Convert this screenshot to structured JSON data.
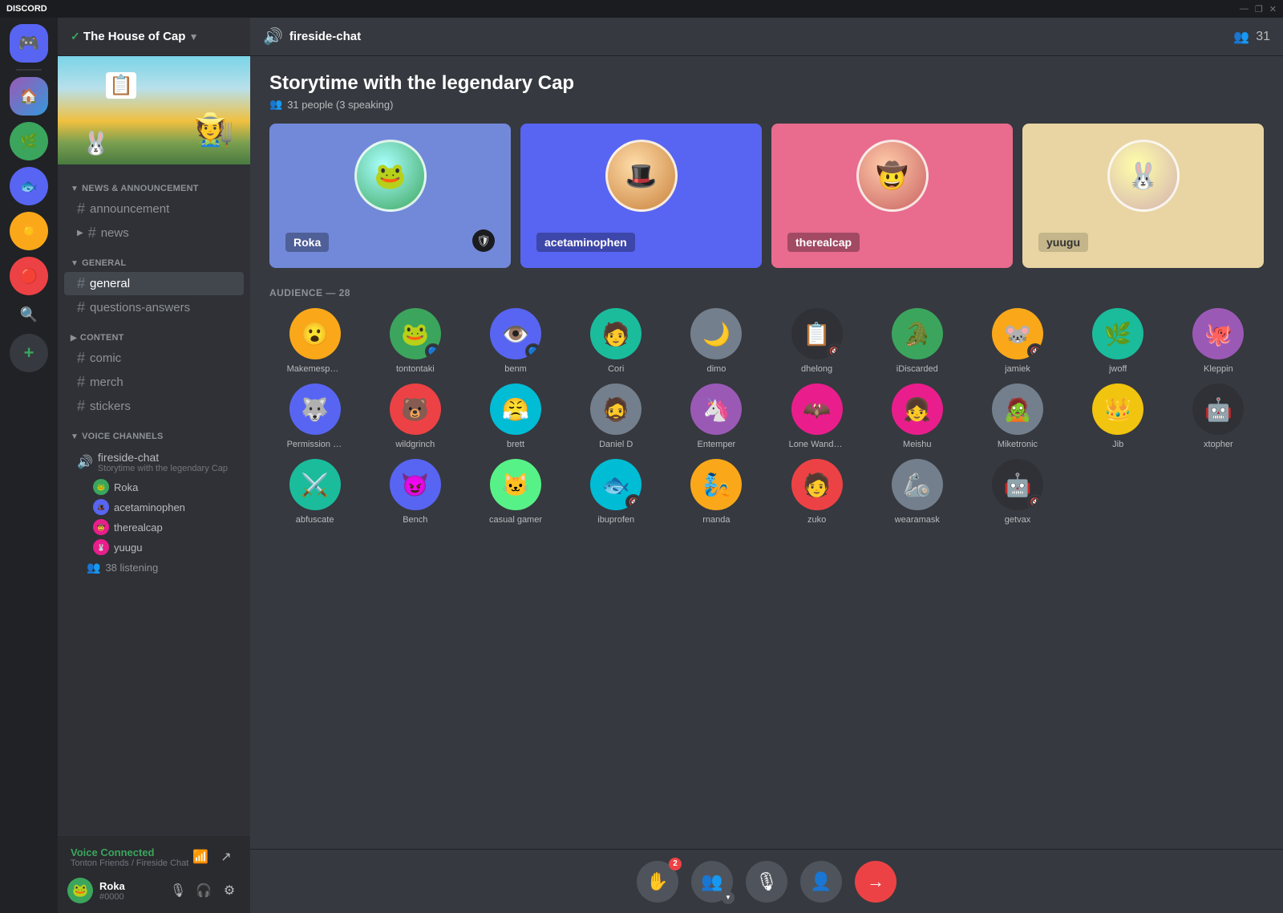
{
  "titlebar": {
    "app_name": "DISCORD",
    "controls": [
      "—",
      "❐",
      "✕"
    ]
  },
  "server": {
    "name": "The House of Cap",
    "banner_emoji": "🏠"
  },
  "channel_header": {
    "icon": "🔊",
    "name": "fireside-chat",
    "listener_count": "31"
  },
  "stage": {
    "title": "Storytime with the legendary Cap",
    "people_count": "31",
    "speaking_count": "3",
    "meta": "31 people (3 speaking)"
  },
  "speakers": [
    {
      "id": "roka",
      "name": "Roka",
      "card_class": "speaker-card-blue",
      "avatar_emoji": "🐸",
      "has_shield": true
    },
    {
      "id": "acetaminophen",
      "name": "acetaminophen",
      "card_class": "speaker-card-darkblue",
      "avatar_emoji": "🎩",
      "has_shield": false
    },
    {
      "id": "therealcap",
      "name": "therealcap",
      "card_class": "speaker-card-pink",
      "avatar_emoji": "🤠",
      "has_shield": false
    },
    {
      "id": "yuugu",
      "name": "yuugu",
      "card_class": "speaker-card-cream",
      "avatar_emoji": "🐰",
      "has_shield": false
    }
  ],
  "audience": {
    "label": "AUDIENCE — 28",
    "members": [
      {
        "name": "Makemespeakrr",
        "emoji": "😮",
        "color": "av-orange"
      },
      {
        "name": "tontontaki",
        "emoji": "🐸",
        "color": "av-green",
        "badge": "🔵"
      },
      {
        "name": "benm",
        "emoji": "👁️",
        "color": "av-blue",
        "badge": "🔵"
      },
      {
        "name": "Cori",
        "emoji": "🧑",
        "color": "av-teal"
      },
      {
        "name": "dimo",
        "emoji": "🌙",
        "color": "av-grey"
      },
      {
        "name": "dhelong",
        "emoji": "📋",
        "color": "av-dark",
        "badge": "🔇"
      },
      {
        "name": "iDiscarded",
        "emoji": "🐊",
        "color": "av-green"
      },
      {
        "name": "jamiek",
        "emoji": "🐭",
        "color": "av-orange",
        "badge": "🔇"
      },
      {
        "name": "jwoff",
        "emoji": "🌿",
        "color": "av-teal"
      },
      {
        "name": "Kleppin",
        "emoji": "🐙",
        "color": "av-purple"
      },
      {
        "name": "Permission Man",
        "emoji": "🐺",
        "color": "av-blue"
      },
      {
        "name": "wildgrinch",
        "emoji": "🐻",
        "color": "av-red"
      },
      {
        "name": "brett",
        "emoji": "😤",
        "color": "av-cyan"
      },
      {
        "name": "Daniel D",
        "emoji": "🧔",
        "color": "av-grey"
      },
      {
        "name": "Entemper",
        "emoji": "🦄",
        "color": "av-purple"
      },
      {
        "name": "Lone Wanderer",
        "emoji": "🦇",
        "color": "av-pink"
      },
      {
        "name": "Meishu",
        "emoji": "👧",
        "color": "av-pink"
      },
      {
        "name": "Miketronic",
        "emoji": "🧟",
        "color": "av-grey"
      },
      {
        "name": "Jib",
        "emoji": "👑",
        "color": "av-yellow"
      },
      {
        "name": "xtopher",
        "emoji": "🤖",
        "color": "av-dark"
      },
      {
        "name": "abfuscate",
        "emoji": "⚔️",
        "color": "av-teal"
      },
      {
        "name": "Bench",
        "emoji": "😈",
        "color": "av-blue"
      },
      {
        "name": "casual gamer",
        "emoji": "🐱",
        "color": "av-lgreen"
      },
      {
        "name": "ibuprofen",
        "emoji": "🐟",
        "color": "av-cyan",
        "badge": "🔇"
      },
      {
        "name": "rnanda",
        "emoji": "🧞",
        "color": "av-orange"
      },
      {
        "name": "zuko",
        "emoji": "🧑",
        "color": "av-red"
      },
      {
        "name": "wearamask",
        "emoji": "🦾",
        "color": "av-grey"
      },
      {
        "name": "getvax",
        "emoji": "🤖",
        "color": "av-dark",
        "badge": "🔇"
      }
    ]
  },
  "sidebar_categories": [
    {
      "name": "NEWS & ANNOUNCEMENT",
      "channels": [
        {
          "name": "announcement",
          "type": "text"
        },
        {
          "name": "news",
          "type": "text"
        }
      ]
    },
    {
      "name": "GENERAL",
      "channels": [
        {
          "name": "general",
          "type": "text",
          "active": true
        },
        {
          "name": "questions-answers",
          "type": "text"
        }
      ]
    },
    {
      "name": "CONTENT",
      "channels": [
        {
          "name": "comic",
          "type": "text"
        },
        {
          "name": "merch",
          "type": "text"
        },
        {
          "name": "stickers",
          "type": "text"
        }
      ]
    }
  ],
  "voice_section": {
    "category": "VOICE CHANNELS",
    "channel_name": "fireside-chat",
    "channel_subtitle": "Storytime with the legendary Cap",
    "speakers": [
      "Roka",
      "acetaminophen",
      "therealcap",
      "yuugu"
    ],
    "listeners_count": "38 listening"
  },
  "bottom_status": {
    "voice_connected": "Voice Connected",
    "voice_location": "Tonton Friends / Fireside Chat"
  },
  "user_panel": {
    "name": "Roka",
    "discriminator": "#0000"
  },
  "bottom_buttons": [
    {
      "id": "raise-hand",
      "emoji": "✋",
      "badge": "2"
    },
    {
      "id": "invite",
      "emoji": "👥",
      "has_arrow": true
    },
    {
      "id": "mic",
      "emoji": "🎙️"
    },
    {
      "id": "add-person",
      "emoji": "👤+"
    },
    {
      "id": "leave",
      "emoji": "→",
      "is_red": true
    }
  ]
}
